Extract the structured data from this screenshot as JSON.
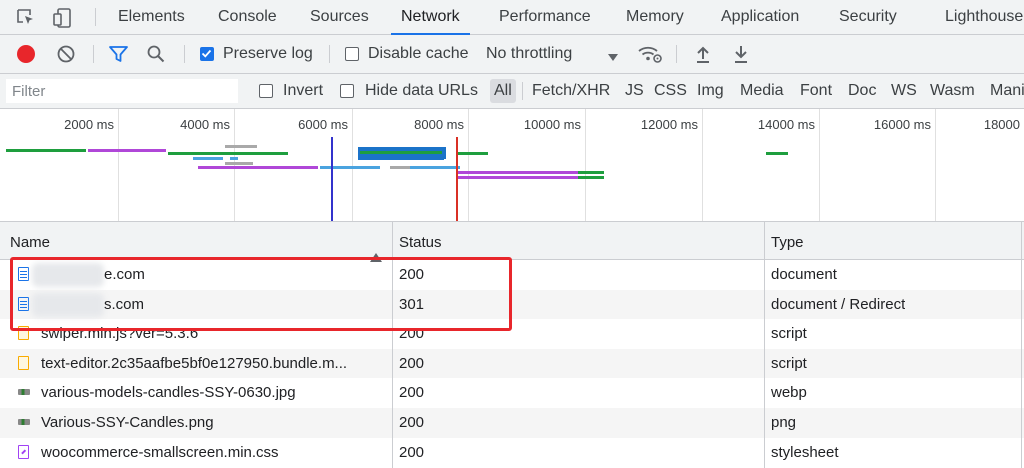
{
  "tabs": [
    "Elements",
    "Console",
    "Sources",
    "Network",
    "Performance",
    "Memory",
    "Application",
    "Security",
    "Lighthouse"
  ],
  "active_tab": "Network",
  "toolbar": {
    "preserve_log_label": "Preserve log",
    "preserve_log_checked": true,
    "disable_cache_label": "Disable cache",
    "disable_cache_checked": false,
    "throttling": "No throttling"
  },
  "filter": {
    "placeholder": "Filter",
    "invert_label": "Invert",
    "hide_data_urls_label": "Hide data URLs",
    "types": [
      "All",
      "Fetch/XHR",
      "JS",
      "CSS",
      "Img",
      "Media",
      "Font",
      "Doc",
      "WS",
      "Wasm",
      "Mani"
    ],
    "active_type": "All"
  },
  "overview": {
    "ticks": [
      "2000 ms",
      "4000 ms",
      "6000 ms",
      "8000 ms",
      "10000 ms",
      "12000 ms",
      "14000 ms",
      "16000 ms",
      "18000"
    ],
    "dom_content_loaded_color": "#3333cc",
    "load_color": "#d93025"
  },
  "table": {
    "columns": [
      "Name",
      "Status",
      "Type"
    ],
    "sort_column": "Name",
    "rows": [
      {
        "name": "e.com",
        "status": "200",
        "type": "document",
        "icon": "document-icon",
        "blurred": true
      },
      {
        "name": "s.com",
        "status": "301",
        "type": "document / Redirect",
        "icon": "document-icon",
        "blurred": true
      },
      {
        "name": "swiper.min.js?ver=5.3.6",
        "status": "200",
        "type": "script",
        "icon": "script-file-icon",
        "blurred": false
      },
      {
        "name": "text-editor.2c35aafbe5bf0e127950.bundle.m...",
        "status": "200",
        "type": "script",
        "icon": "script-file-icon",
        "blurred": false
      },
      {
        "name": "various-models-candles-SSY-0630.jpg",
        "status": "200",
        "type": "webp",
        "icon": "image-file-icon",
        "blurred": false
      },
      {
        "name": "Various-SSY-Candles.png",
        "status": "200",
        "type": "png",
        "icon": "image-file-icon",
        "blurred": false
      },
      {
        "name": "woocommerce-smallscreen.min.css",
        "status": "200",
        "type": "stylesheet",
        "icon": "stylesheet-file-icon",
        "blurred": false
      }
    ]
  },
  "colors": {
    "accent": "#1a73e8",
    "record": "#e8262b",
    "highlight": "#e8262b"
  }
}
